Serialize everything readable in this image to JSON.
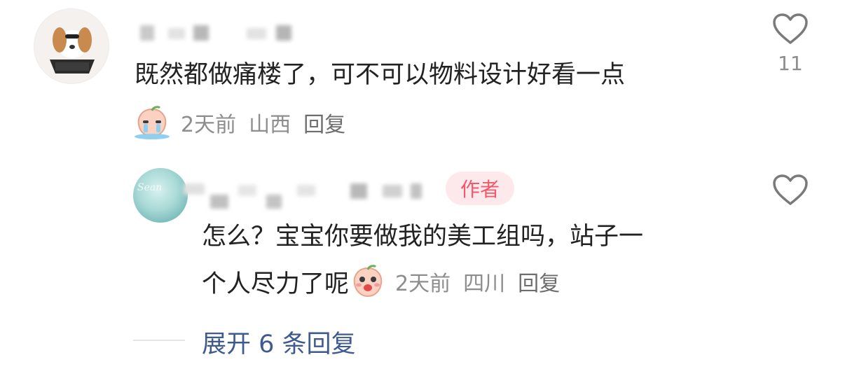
{
  "comment1": {
    "text": "既然都做痛楼了，可不可以物料设计好看一点",
    "time": "2天前",
    "location": "山西",
    "reply_label": "回复",
    "like_count": "11",
    "sticker_icon": "crying-peach-sticker"
  },
  "comment2": {
    "badge": "作者",
    "avatar_text": "Sean",
    "text_line1": "怎么？宝宝你要做我的美工组吗，站子一",
    "text_line2": "个人尽力了呢",
    "time": "2天前",
    "location": "四川",
    "reply_label": "回复",
    "sticker_icon": "laughing-peach-sticker"
  },
  "expand_replies": "展开 6 条回复",
  "icons": {
    "like": "heart-outline-icon"
  },
  "colors": {
    "link": "#3e5a8e",
    "badge_bg": "#fde9ec",
    "badge_text": "#f0596a",
    "meta": "#8d8d8d"
  }
}
